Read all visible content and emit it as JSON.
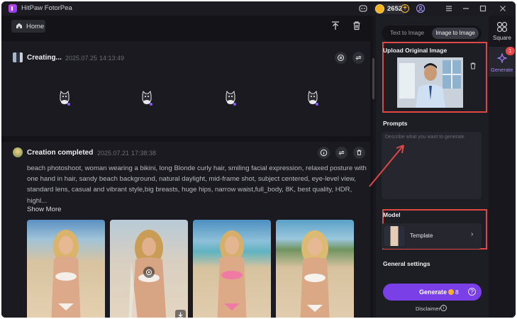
{
  "app": {
    "title": "HitPaw FotorPea",
    "coins": "2652"
  },
  "toolbar": {
    "home_label": "Home"
  },
  "tasks": [
    {
      "title": "Creating...",
      "date": "2025.07.25",
      "time": "14:13:49"
    },
    {
      "title": "Creation completed",
      "date": "2025.07.21",
      "time": "17:38:38",
      "prompt": "beach photoshoot, woman wearing a bikini, long Blonde curly hair, smiling facial expression, relaxed posture with one hand in hair, sandy beach background, natural daylight, mid-frame shot, subject centered, eye-level view, standard lens, casual and vibrant style,big breasts, huge hips, narrow waist,full_body, 8K, best quality, HDR, highl...",
      "show_more": "Show More"
    }
  ],
  "panel": {
    "tabs": [
      "Text to Image",
      "Image to Image"
    ],
    "active_tab": "Image to Image",
    "upload_title": "Upload Original Image",
    "prompts_title": "Prompts",
    "prompt_placeholder": "Describe what you want to generate",
    "prompt_value": "",
    "model_title": "Model",
    "model_name": "Template",
    "general_settings": "General settings",
    "generate_label": "Generate",
    "generate_cost": "8",
    "disclaimer": "Disclaimer"
  },
  "rail": {
    "square": "Square",
    "generate": "Generate",
    "badge": "1"
  },
  "colors": {
    "accent": "#7a3fe6",
    "highlight": "#e04646",
    "coin": "#f5b324"
  },
  "icons": [
    "discord-icon",
    "user-icon",
    "menu-icon",
    "minimize-icon",
    "maximize-icon",
    "close-icon",
    "home-icon",
    "upload-top-icon",
    "trash-icon",
    "cancel-icon",
    "retry-icon",
    "info-icon",
    "download-icon",
    "eye-icon",
    "square-grid-icon",
    "sparkle-icon",
    "chevron-right-icon",
    "question-icon"
  ]
}
